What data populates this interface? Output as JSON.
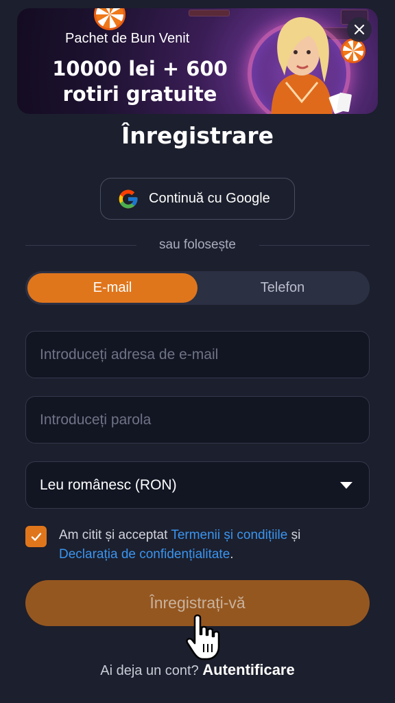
{
  "banner": {
    "subtitle": "Pachet de Bun Venit",
    "headline": "10000 lei + 600 rotiri gratuite",
    "close_icon": "close-icon"
  },
  "page": {
    "title": "Înregistrare"
  },
  "google": {
    "label": "Continuă cu Google",
    "icon": "google-icon"
  },
  "divider": {
    "text": "sau folosește"
  },
  "tabs": [
    {
      "label": "E-mail",
      "active": true
    },
    {
      "label": "Telefon",
      "active": false
    }
  ],
  "form": {
    "email_placeholder": "Introduceți adresa de e-mail",
    "password_placeholder": "Introduceți parola",
    "currency_value": "Leu românesc (RON)",
    "consent_prefix": "Am citit și acceptat ",
    "terms_link": "Termenii și condițiile",
    "consent_middle": " și ",
    "privacy_link": "Declarația de confidențialitate",
    "consent_suffix": ".",
    "checked": true,
    "submit_label": "Înregistrați-vă"
  },
  "footer": {
    "question": "Ai deja un cont? ",
    "login_link": "Autentificare"
  },
  "colors": {
    "background": "#1c1f2d",
    "accent": "#e0761c",
    "submit_disabled": "#955720",
    "link": "#3a95f0"
  }
}
